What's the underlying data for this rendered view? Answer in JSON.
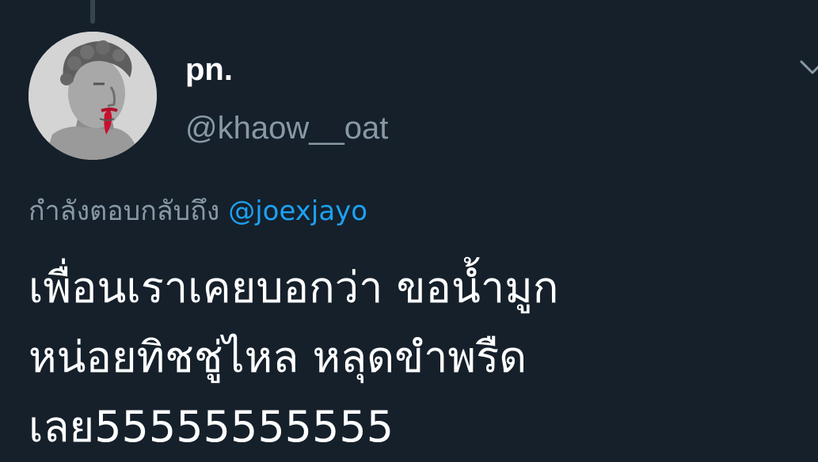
{
  "tweet": {
    "display_name": "pn.",
    "handle": "@khaow__oat",
    "reply_prefix": "กำลังตอบกลับถึง ",
    "reply_mention": "@joexjayo",
    "body_lines": [
      "เพื่อนเราเคยบอกว่า ขอน้ำมูก",
      "หน่อยทิชชู่ไหล หลุดขำพรืด",
      "เลย55555555555"
    ]
  },
  "icons": {
    "avatar": "statue-head-avatar",
    "menu": "chevron-down-icon"
  },
  "colors": {
    "background": "#15202b",
    "primary_text": "#ffffff",
    "secondary_text": "#8899a6",
    "link": "#1da1f2"
  }
}
